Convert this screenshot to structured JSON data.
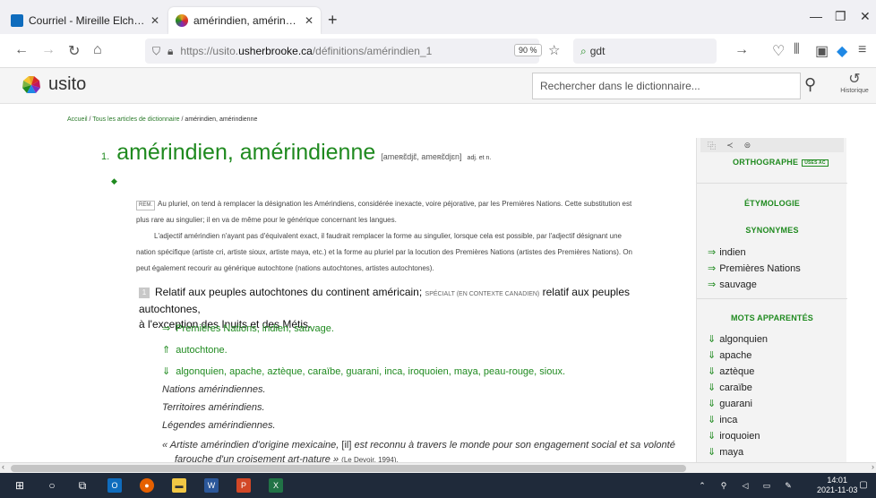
{
  "browser": {
    "tabs": [
      {
        "label": "Courriel - Mireille Elchacar - Ou",
        "favicon_color": "#0f6cbd"
      },
      {
        "label": "amérindien, amérindienne | Usit",
        "favicon_color": "#e8a020"
      }
    ],
    "new_tab": "+",
    "url_prefix": "https://usito.",
    "url_domain": "usherbrooke.ca",
    "url_path": "/définitions/amérindien_1",
    "zoom": "90 %",
    "search_text": "gdt"
  },
  "site": {
    "name": "usito",
    "search_placeholder": "Rechercher dans le dictionnaire...",
    "history_label": "Historique"
  },
  "breadcrumb": {
    "home": "Accueil",
    "all": "Tous les articles de dictionnaire",
    "current": "amérindien, amérindienne"
  },
  "entry": {
    "number": "1.",
    "headword": "amérindien, amérindienne",
    "pronunciation": "[ameʀɛ̃djɛ̃, ameʀɛ̃djɛn]",
    "pos": "adj. et n.",
    "rem_tag": "REM.",
    "rem_line1": "Au pluriel, on tend à remplacer la désignation les Amérindiens, considérée inexacte, voire péjorative, par les Premières Nations. Cette substitution est",
    "rem_line2": "plus rare au singulier; il en va de même pour le générique concernant les langues.",
    "rem2_line1": "L'adjectif amérindien n'ayant pas d'équivalent exact, il faudrait remplacer la forme au singulier, lorsque cela est possible, par l'adjectif désignant une",
    "rem2_line2": "nation spécifique (artiste cri, artiste sioux, artiste maya, etc.) et la forme au pluriel par la locution des Premières Nations (artistes des Premières Nations). On",
    "rem2_line3": "peut également recourir au générique autochtone (nations autochtones, artistes autochtones).",
    "sense_number": "1",
    "sense_text1": "Relatif aux peuples autochtones du continent américain;",
    "sense_special": "SPÉCIALT (EN CONTEXTE CANADIEN)",
    "sense_text2": "relatif aux peuples autochtones,",
    "sense_text3": "à l'exception des Inuits et des Métis.",
    "synonyms_line": "Premières Nations, indien, sauvage.",
    "generic_line": "autochtone.",
    "specific_line": "algonquien, apache, aztèque, caraïbe, guarani, inca, iroquoien, maya, peau-rouge, sioux.",
    "examples": [
      "Nations amérindiennes.",
      "Territoires amérindiens.",
      "Légendes amérindiennes."
    ],
    "citation_a": "« Artiste amérindien d'origine mexicaine,",
    "citation_b": "[il]",
    "citation_c": "est reconnu à travers le monde pour son engagement social et sa volonté",
    "citation_d": "farouche d'un croisement art-nature »",
    "citation_src": "(Le Devoir, 1994)."
  },
  "sidebar": {
    "orthographe": "ORTHOGRAPHE",
    "usesac": "USES AC",
    "etymologie": "ÉTYMOLOGIE",
    "synonymes": "SYNONYMES",
    "synonyms": [
      "indien",
      "Premières Nations",
      "sauvage"
    ],
    "mots_apparentes": "MOTS APPARENTÉS",
    "related": [
      "algonquien",
      "apache",
      "aztèque",
      "caraïbe",
      "guarani",
      "inca",
      "iroquoien",
      "maya"
    ]
  },
  "taskbar": {
    "time": "14:01",
    "date": "2021-11-03"
  }
}
